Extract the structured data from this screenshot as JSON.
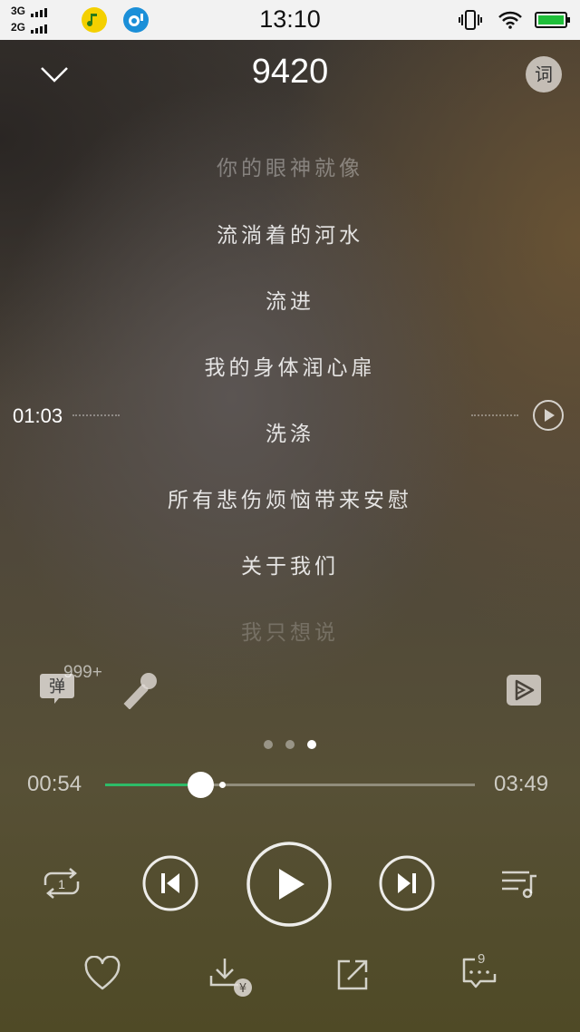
{
  "status_bar": {
    "network_1": "3G",
    "network_2": "2G",
    "time": "13:10",
    "icons": [
      "qq-music-app-icon",
      "notification-app-icon",
      "vibrate-icon",
      "wifi-icon",
      "battery-icon"
    ],
    "battery_level": 1.0
  },
  "header": {
    "title": "9420",
    "collapse_icon": "chevron-down-icon",
    "lyric_button_label": "词"
  },
  "lyrics": {
    "lines": [
      "你的眼神就像",
      "流淌着的河水",
      "流进",
      "我的身体润心扉",
      "洗涤",
      "所有悲伤烦恼带来安慰",
      "关于我们",
      "我只想说"
    ],
    "seek_time": "01:03"
  },
  "actions": {
    "danmu_label": "弹",
    "danmu_count": "999+",
    "mic_icon": "microphone-icon",
    "mv_icon": "mv-play-icon"
  },
  "pager": {
    "count": 3,
    "active": 2
  },
  "progress": {
    "current": "00:54",
    "total": "03:49",
    "played_fraction": 0.2576,
    "buffered_fraction": 0.31
  },
  "controls": {
    "repeat_badge": "1",
    "icons": [
      "repeat-one-icon",
      "previous-icon",
      "play-icon",
      "next-icon",
      "playlist-icon"
    ]
  },
  "bottom_bar": {
    "icons": [
      "heart-icon",
      "download-icon",
      "share-icon",
      "comment-icon"
    ],
    "download_badge": "¥",
    "comment_count": "9"
  },
  "colors": {
    "accent": "#2dbb68",
    "battery": "#1fbf3a"
  }
}
